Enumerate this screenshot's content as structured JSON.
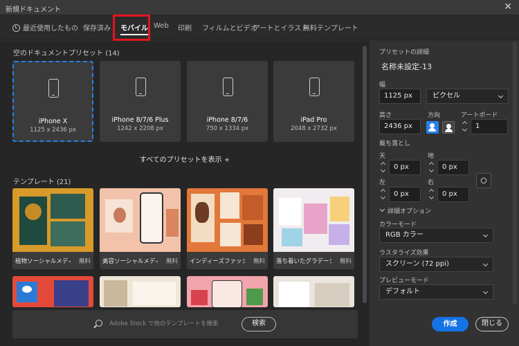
{
  "window": {
    "title": "新規ドキュメント",
    "close_glyph": "✕"
  },
  "tabs": [
    {
      "label": "最近使用したもの",
      "icon": "clock-icon"
    },
    {
      "label": "保存済み"
    },
    {
      "label": "モバイル",
      "active": true
    },
    {
      "label": "Web"
    },
    {
      "label": "印刷"
    },
    {
      "label": "フィルムとビデオ"
    },
    {
      "label": "アートとイラスト"
    },
    {
      "label": "無料テンプレート"
    }
  ],
  "blank_presets": {
    "title": "空のドキュメントプリセット (14)",
    "items": [
      {
        "name": "iPhone X",
        "size": "1125 x 2436 px",
        "selected": true
      },
      {
        "name": "iPhone 8/7/6 Plus",
        "size": "1242 x 2208 px"
      },
      {
        "name": "iPhone 8/7/6",
        "size": "750 x 1334 px"
      },
      {
        "name": "iPad Pro",
        "size": "2048 x 2732 px"
      }
    ],
    "show_all": "すべてのプリセットを表示 +"
  },
  "templates": {
    "title": "テンプレート (21)",
    "items": [
      {
        "name": "植物ソーシャルメディア...",
        "badge": "無料"
      },
      {
        "name": "美容ソーシャルメディア...",
        "badge": "無料"
      },
      {
        "name": "インディーズファッション...",
        "badge": "無料"
      },
      {
        "name": "落ち着いたグラデーシ...",
        "badge": "無料"
      }
    ]
  },
  "search": {
    "placeholder": "Adobe Stock で他のテンプレートを検索",
    "button": "検索"
  },
  "details": {
    "heading": "プリセットの詳細",
    "doc_name": "名称未設定-13",
    "width_label": "幅",
    "width_value": "1125 px",
    "unit": "ピクセル",
    "height_label": "高さ",
    "height_value": "2436 px",
    "orientation_label": "方向",
    "artboard_label": "アートボード",
    "artboard_value": "1",
    "bleed_label": "裁ち落とし",
    "bleed_top_label": "天",
    "bleed_top": "0 px",
    "bleed_bottom_label": "地",
    "bleed_bottom": "0 px",
    "bleed_left_label": "左",
    "bleed_left": "0 px",
    "bleed_right_label": "右",
    "bleed_right": "0 px",
    "advanced_label": "詳細オプション",
    "color_mode_label": "カラーモード",
    "color_mode": "RGB カラー",
    "raster_label": "ラスタライズ効果",
    "raster": "スクリーン (72 ppi)",
    "preview_label": "プレビューモード",
    "preview": "デフォルト"
  },
  "actions": {
    "create": "作成",
    "close": "閉じる"
  },
  "colors": {
    "accent": "#2680eb",
    "primary_button": "#1473e6",
    "highlight_box": "#e5141e"
  }
}
